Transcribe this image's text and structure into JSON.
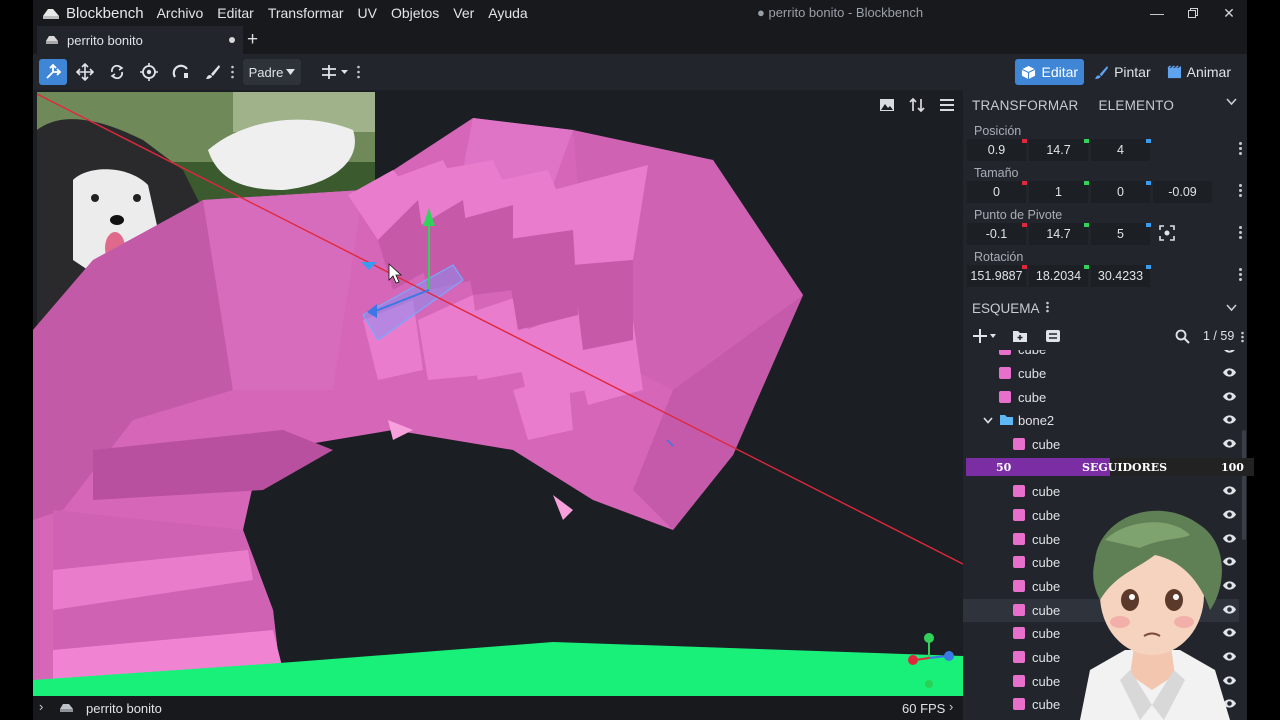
{
  "app": {
    "name": "Blockbench",
    "window_title": "● perrito bonito - Blockbench",
    "menu": [
      "Archivo",
      "Editar",
      "Transformar",
      "UV",
      "Objetos",
      "Ver",
      "Ayuda"
    ]
  },
  "tabs": [
    {
      "label": "perrito bonito"
    }
  ],
  "toolbar": {
    "pivot_mode": "Padre",
    "modes": [
      {
        "label": "Editar",
        "active": true
      },
      {
        "label": "Pintar",
        "active": false
      },
      {
        "label": "Animar",
        "active": false
      }
    ]
  },
  "panel": {
    "tab_transform": "TRANSFORMAR",
    "tab_element": "ELEMENTO",
    "position_label": "Posición",
    "position": [
      "0.9",
      "14.7",
      "4"
    ],
    "size_label": "Tamaño",
    "size": [
      "0",
      "1",
      "0",
      "-0.09"
    ],
    "pivot_label": "Punto de Pivote",
    "pivot": [
      "-0.1",
      "14.7",
      "5"
    ],
    "rotation_label": "Rotación",
    "rotation": [
      "151.9887",
      "18.2034",
      "30.4233"
    ],
    "outliner_title": "ESQUEMA",
    "outliner_count": "1 / 59"
  },
  "outliner": {
    "rows": [
      {
        "label": "cube",
        "indent": 1
      },
      {
        "label": "cube",
        "indent": 1
      },
      {
        "label": "cube",
        "indent": 1
      },
      {
        "label": "bone2",
        "indent": 1,
        "type": "group"
      },
      {
        "label": "cube",
        "indent": 2
      },
      {
        "label": "cube",
        "indent": 2
      },
      {
        "label": "cube",
        "indent": 2
      },
      {
        "label": "cube",
        "indent": 2
      },
      {
        "label": "cube",
        "indent": 2
      },
      {
        "label": "cube",
        "indent": 2
      },
      {
        "label": "cube",
        "indent": 2,
        "selected": true
      },
      {
        "label": "cube",
        "indent": 2
      },
      {
        "label": "cube",
        "indent": 2
      },
      {
        "label": "cube",
        "indent": 2
      },
      {
        "label": "cube",
        "indent": 2
      }
    ]
  },
  "overlay": {
    "followers_current": "50",
    "followers_label": "SEGUIDORES",
    "followers_goal": "100",
    "followers_progress": 0.5
  },
  "status": {
    "project": "perrito bonito",
    "fps": "60 FPS"
  },
  "colors": {
    "accent": "#3f87d6",
    "model_pink": "#e070c0",
    "ground_green": "#18f07a",
    "axis_x": "#e0283c",
    "axis_y": "#32d25a",
    "axis_z": "#3a78e6"
  }
}
